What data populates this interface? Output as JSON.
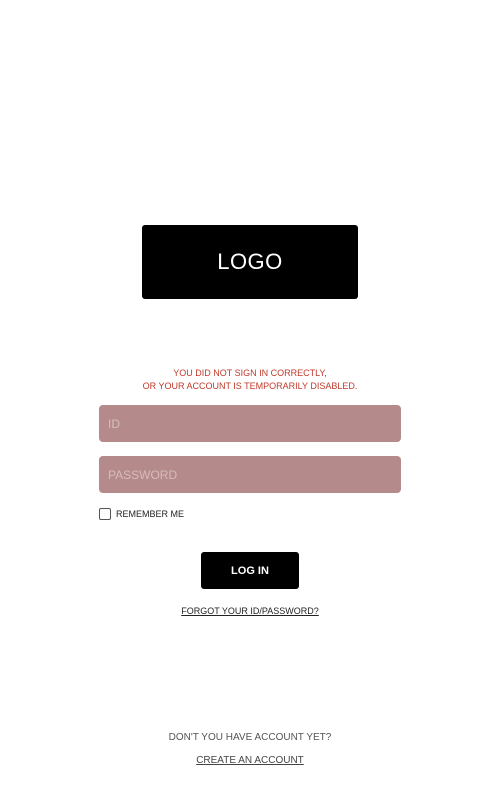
{
  "logo": {
    "text": "LOGO"
  },
  "error": {
    "line1": "YOU DID NOT SIGN IN CORRECTLY,",
    "line2": "OR YOUR ACCOUNT IS TEMPORARILY DISABLED."
  },
  "form": {
    "id_placeholder": "ID",
    "password_placeholder": "PASSWORD",
    "remember_label": "REMEMBER ME",
    "login_label": "LOG IN",
    "forgot_link": "FORGOT YOUR ID/PASSWORD?"
  },
  "footer": {
    "prompt": "DON'T YOU HAVE ACCOUNT YET?",
    "create_link": "CREATE AN ACCOUNT"
  },
  "colors": {
    "field_background": "#b48a8a",
    "error_text": "#c0392b",
    "button_background": "#000000"
  }
}
